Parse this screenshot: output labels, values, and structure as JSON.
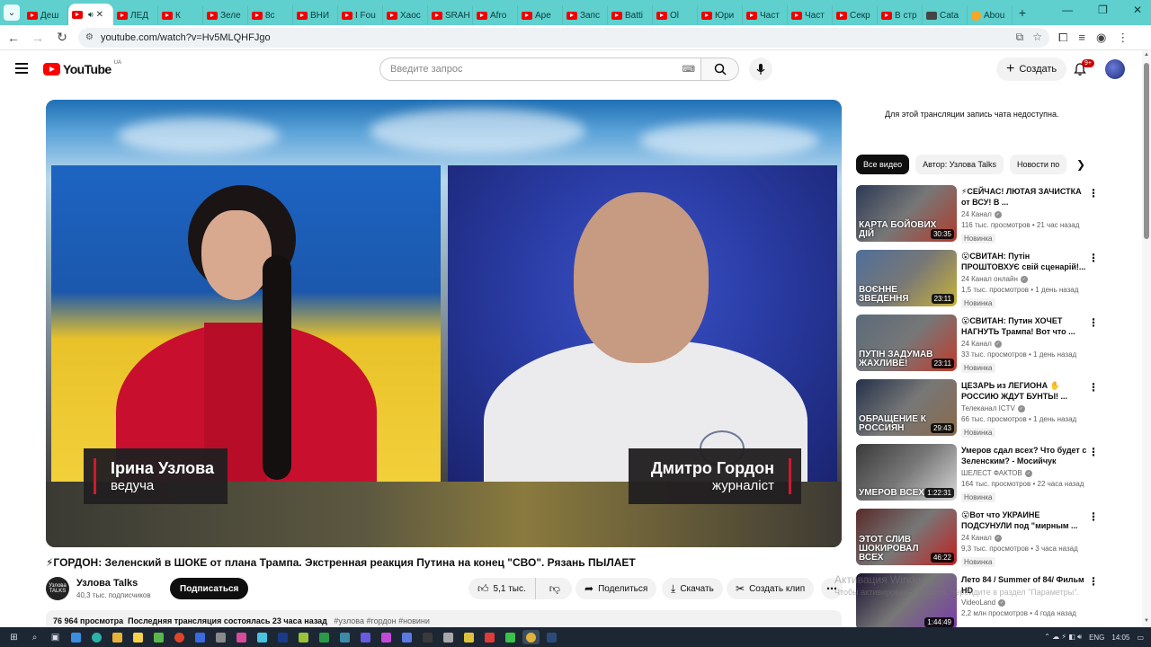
{
  "browser": {
    "tabs": [
      {
        "label": "Деш",
        "type": "yt"
      },
      {
        "label": "",
        "type": "yt",
        "active": true
      },
      {
        "label": "ЛЕД",
        "type": "yt"
      },
      {
        "label": "К",
        "type": "yt"
      },
      {
        "label": "Зеле",
        "type": "yt"
      },
      {
        "label": "8с",
        "type": "yt"
      },
      {
        "label": "ВНИ",
        "type": "yt"
      },
      {
        "label": "I Fou",
        "type": "yt"
      },
      {
        "label": "Хаос",
        "type": "yt"
      },
      {
        "label": "SRAH",
        "type": "yt"
      },
      {
        "label": "Afro",
        "type": "yt"
      },
      {
        "label": "Ape",
        "type": "yt"
      },
      {
        "label": "Запс",
        "type": "yt"
      },
      {
        "label": "Batti",
        "type": "yt"
      },
      {
        "label": "Ol",
        "type": "yt"
      },
      {
        "label": "Юри",
        "type": "yt"
      },
      {
        "label": "Част",
        "type": "yt"
      },
      {
        "label": "Част",
        "type": "yt"
      },
      {
        "label": "Секр",
        "type": "yt"
      },
      {
        "label": "В стр",
        "type": "yt"
      },
      {
        "label": "Cata",
        "type": "other"
      },
      {
        "label": "Abou",
        "type": "fox"
      }
    ],
    "url": "youtube.com/watch?v=Hv5MLQHFJgo"
  },
  "header": {
    "logo_text": "YouTube",
    "country": "UA",
    "search_placeholder": "Введите запрос",
    "create_label": "Создать",
    "notif_badge": "9+"
  },
  "player": {
    "host_name": "Ірина Узлова",
    "host_role": "ведуча",
    "guest_name": "Дмитро Гордон",
    "guest_role": "журналіст"
  },
  "video": {
    "title": "⚡ГОРДОН: Зеленский в ШОКЕ от плана Трампа. Экстренная реакция Путина на конец \"СВО\". Рязань ПЫЛАЕТ",
    "channel_name": "Узлова Talks",
    "channel_avatar_text": "Узлова TALKS",
    "subscribers": "40,3 тыс. подписчиков",
    "subscribe_label": "Подписаться",
    "likes": "5,1 тыс.",
    "share_label": "Поделиться",
    "download_label": "Скачать",
    "clip_label": "Создать клип",
    "views": "76 964 просмотра",
    "streamed": "Последняя трансляция состоялась 23 часа назад",
    "tags": "#узлова #гордон #новини"
  },
  "sidebar": {
    "chat_note": "Для этой трансляции запись чата недоступна.",
    "chips": [
      "Все видео",
      "Автор: Узлова Talks",
      "Новости по"
    ],
    "items": [
      {
        "title": "⚡СЕЙЧАС! ЛЮТАЯ ЗАЧИСТКА от ВСУ! В ...",
        "channel": "24 Канал",
        "stats": "116 тыс. просмотров • 21 час назад",
        "badge": "Новинка",
        "duration": "30:35",
        "thumb_text": "КАРТА БОЙОВИХ ДІЙ",
        "colors": [
          "#2b3a55",
          "#b23a2a"
        ]
      },
      {
        "title": "😮СВИТАН: Путін ПРОШТОВХУЄ свій сценарій!...",
        "channel": "24 Канал онлайн",
        "stats": "1,5 тыс. просмотров • 1 день назад",
        "badge": "Новинка",
        "duration": "23:11",
        "thumb_text": "ВОЄННЕ ЗВЕДЕННЯ",
        "colors": [
          "#4f6f9a",
          "#c9b23a"
        ]
      },
      {
        "title": "😮СВИТАН: Путин ХОЧЕТ НАГНУТЬ Трампа! Вот что ...",
        "channel": "24 Канал",
        "stats": "33 тыс. просмотров • 1 день назад",
        "badge": "Новинка",
        "duration": "23:11",
        "thumb_text": "ПУТІН ЗАДУМАВ ЖАХЛИВЕ!",
        "colors": [
          "#5a6a7a",
          "#c23a2a"
        ]
      },
      {
        "title": "ЦЕЗАРЬ из ЛЕГИОНА ✋ РОССИЮ ЖДУТ БУНТЫ! ...",
        "channel": "Телеканал ICTV",
        "stats": "66 тыс. просмотров • 1 день назад",
        "badge": "Новинка",
        "duration": "29:43",
        "thumb_text": "ОБРАЩЕНИЕ К РОССИЯН",
        "colors": [
          "#23324a",
          "#8a6a4a"
        ]
      },
      {
        "title": "Умеров сдал всех? Что будет с Зеленским? - Мосийчук",
        "channel": "ШЕЛЕСТ ФАКТОВ",
        "stats": "164 тыс. просмотров • 22 часа назад",
        "badge": "Новинка",
        "duration": "1:22:31",
        "thumb_text": "УМЕРОВ ВСЕХ С",
        "colors": [
          "#3a3a3a",
          "#d8d8d8"
        ]
      },
      {
        "title": "😮Вот что УКРАИНЕ ПОДСУНУЛИ под \"мирным ...",
        "channel": "24 Канал",
        "stats": "9,3 тыс. просмотров • 3 часа назад",
        "badge": "Новинка",
        "duration": "46:22",
        "thumb_text": "ЭТОТ СЛИВ ШОКИРОВАЛ ВСЕХ",
        "colors": [
          "#5a2a2a",
          "#c32020"
        ]
      },
      {
        "title": "Лето 84 / Summer of 84/ Фильм HD",
        "channel": "VideoLand",
        "stats": "2,2 млн просмотров • 4 года назад",
        "badge": "",
        "duration": "1:44:49",
        "thumb_text": "",
        "colors": [
          "#1a1030",
          "#7a3aa8"
        ]
      }
    ]
  },
  "watermark": {
    "line1": "Активация Windows",
    "line2": "Чтобы активировать Windows, перейдите в раздел \"Параметры\"."
  },
  "taskbar": {
    "lang": "ENG",
    "time": "14:05"
  }
}
